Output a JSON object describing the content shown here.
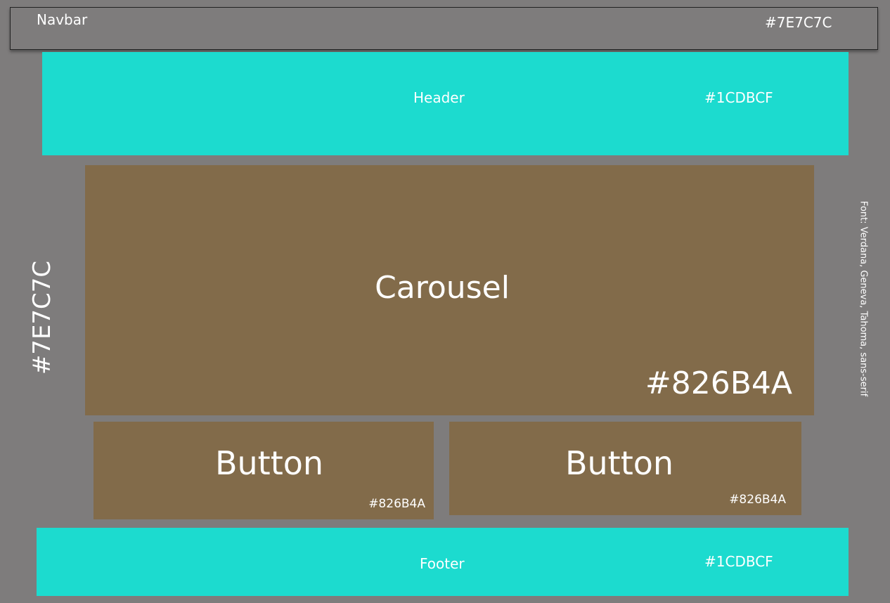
{
  "background_color": "#7E7C7C",
  "background_label": "#7E7C7C",
  "font_note": "Font: Verdana, Geneva, Tahoma, sans-serif",
  "navbar": {
    "label": "Navbar",
    "color_label": "#7E7C7C",
    "color": "#7E7C7C"
  },
  "header": {
    "label": "Header",
    "color_label": "#1CDBCF",
    "color": "#1CDBCF"
  },
  "carousel": {
    "label": "Carousel",
    "color_label": "#826B4A",
    "color": "#826B4A"
  },
  "buttons": [
    {
      "label": "Button",
      "color_label": "#826B4A",
      "color": "#826B4A"
    },
    {
      "label": "Button",
      "color_label": "#826B4A",
      "color": "#826B4A"
    }
  ],
  "footer": {
    "label": "Footer",
    "color_label": "#1CDBCF",
    "color": "#1CDBCF"
  }
}
